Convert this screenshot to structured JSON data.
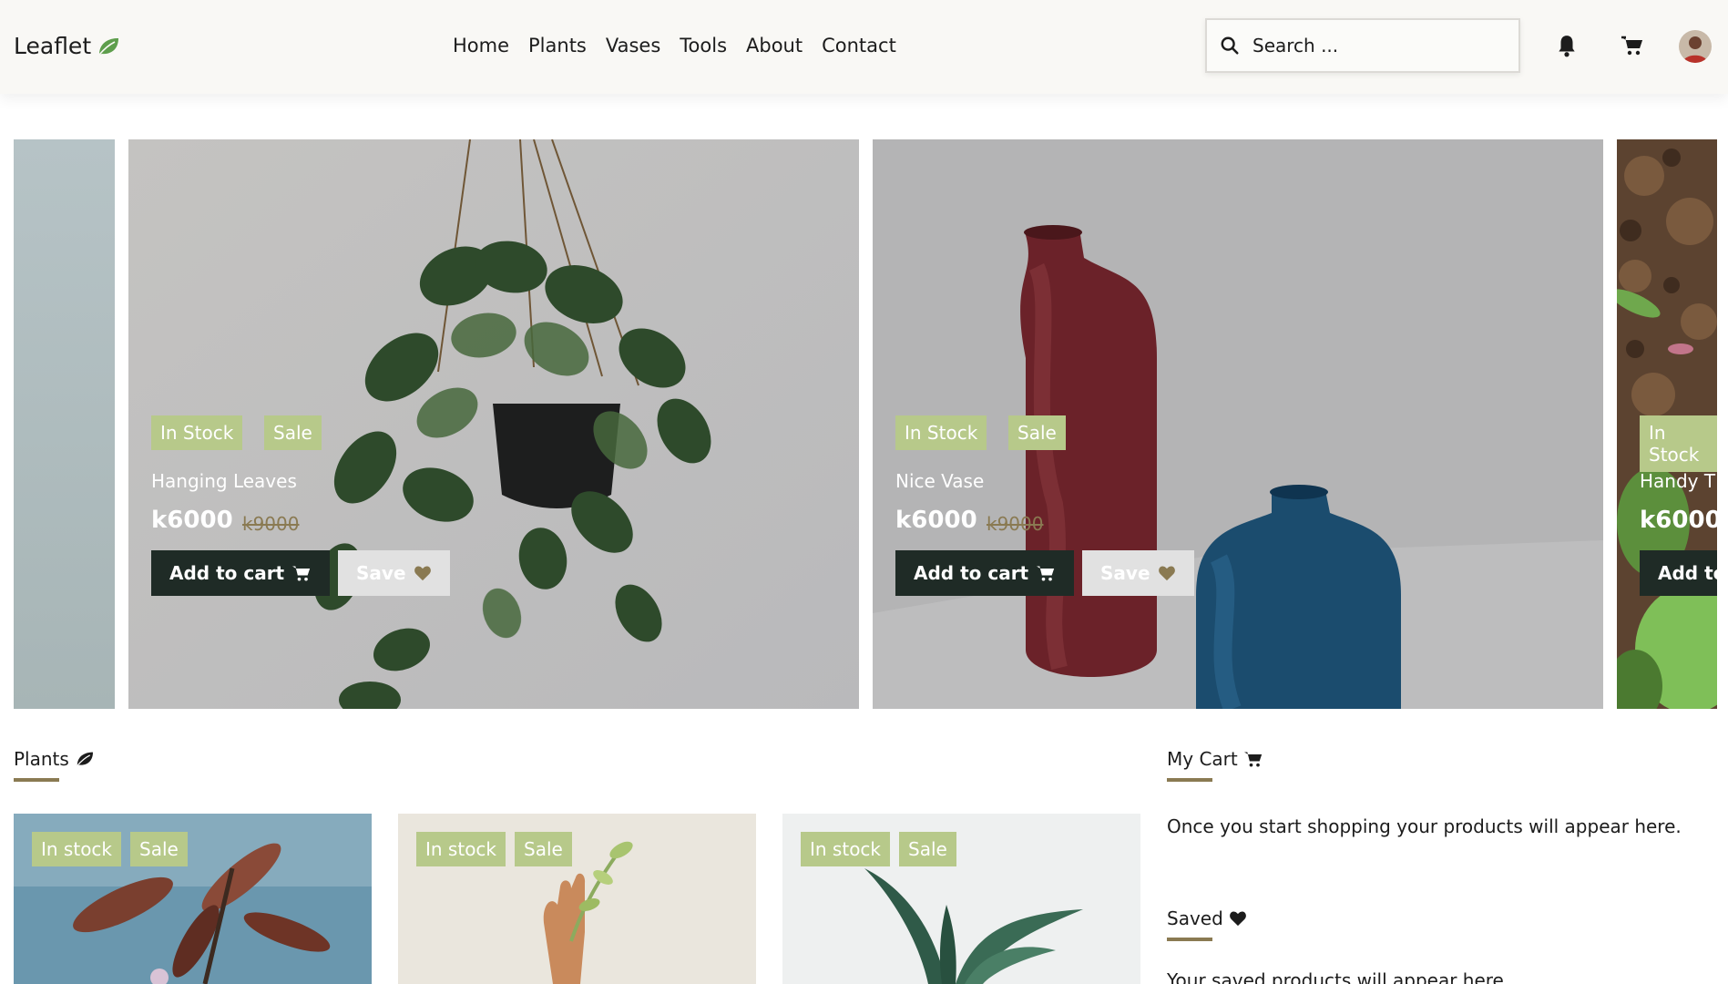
{
  "app": {
    "name": "Leaflet"
  },
  "nav": {
    "items": [
      "Home",
      "Plants",
      "Vases",
      "Tools",
      "About",
      "Contact"
    ]
  },
  "search": {
    "placeholder": "Search ..."
  },
  "colors": {
    "accent": "#b7c98a",
    "brand_dark": "#1f2b26",
    "underline": "#8a7a52",
    "header_bg": "#f9f8f5"
  },
  "icons": {
    "search": "search-icon",
    "notifications": "bell-icon",
    "cart": "cart-icon",
    "save": "heart-icon",
    "logo": "leaf-icon"
  },
  "carousel": {
    "slides": [
      {
        "title": "Hanging Leaves",
        "badge_stock": "In Stock",
        "badge_sale": "Sale",
        "price": "k6000",
        "old_price": "k9000",
        "cart_label": "Add to cart",
        "save_label": "Save"
      },
      {
        "title": "Nice Vase",
        "badge_stock": "In Stock",
        "badge_sale": "Sale",
        "price": "k6000",
        "old_price": "k9000",
        "cart_label": "Add to cart",
        "save_label": "Save"
      },
      {
        "title": "Handy T",
        "badge_stock": "In Stock",
        "price": "k6000",
        "cart_label": "Add to"
      }
    ]
  },
  "plants": {
    "title": "Plants",
    "cards": [
      {
        "badge_stock": "In stock",
        "badge_sale": "Sale"
      },
      {
        "badge_stock": "In stock",
        "badge_sale": "Sale"
      },
      {
        "badge_stock": "In stock",
        "badge_sale": "Sale"
      }
    ]
  },
  "cart": {
    "title": "My Cart",
    "empty_text": "Once you start shopping your products will appear here."
  },
  "saved": {
    "title": "Saved",
    "empty_text": "Your saved products will appear here."
  }
}
